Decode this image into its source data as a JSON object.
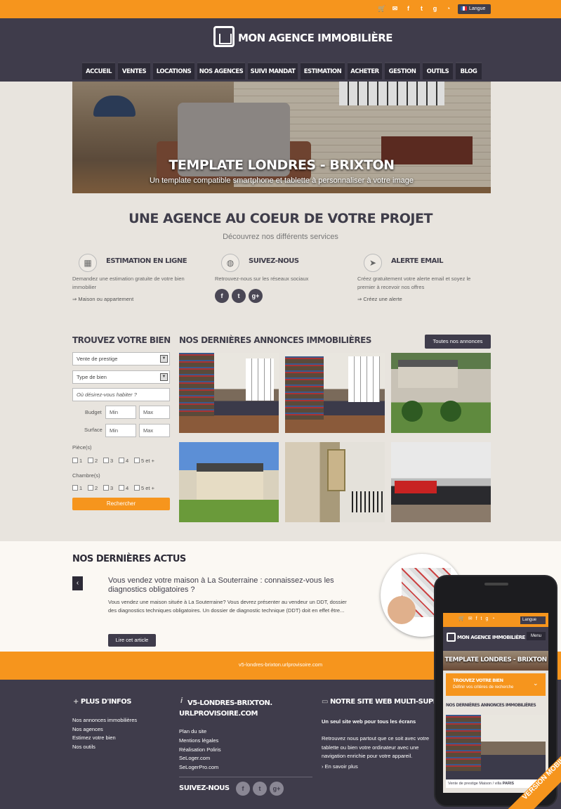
{
  "colors": {
    "accent": "#f6951d",
    "dark": "#3f3c4b",
    "background": "#e8e4de"
  },
  "topbar": {
    "icons": [
      "cart-icon",
      "mail-icon",
      "facebook-icon",
      "twitter-icon",
      "google-plus-icon",
      "rss-icon"
    ],
    "lang_label": "Langue"
  },
  "header": {
    "logo_text": "MON AGENCE IMMOBILIÈRE",
    "nav": [
      "ACCUEIL",
      "VENTES",
      "LOCATIONS",
      "NOS AGENCES",
      "SUIVI MANDAT",
      "ESTIMATION",
      "ACHETER",
      "GESTION",
      "OUTILS",
      "BLOG"
    ]
  },
  "hero": {
    "title": "TEMPLATE LONDRES - BRIXTON",
    "subtitle": "Un template compatible smartphone et tablette à personnaliser à votre image"
  },
  "agence": {
    "title": "UNE AGENCE AU COEUR DE VOTRE PROJET",
    "subtitle": "Découvrez nos différents services",
    "services": [
      {
        "icon": "calculator-icon",
        "title": "ESTIMATION EN LIGNE",
        "text": "Demandez une estimation gratuite de votre bien immobilier",
        "link": "Maison ou appartement"
      },
      {
        "icon": "globe-icon",
        "title": "SUIVEZ-NOUS",
        "text": "Retrouvez-nous sur les réseaux sociaux",
        "link": ""
      },
      {
        "icon": "paper-plane-icon",
        "title": "ALERTE EMAIL",
        "text": "Créez gratuitement votre alerte email et soyez le premier à recevoir nos offres",
        "link": "Créez une alerte"
      }
    ]
  },
  "search": {
    "title": "TROUVEZ VOTRE BIEN",
    "select1": "Vente de prestige",
    "select2": "Type de bien",
    "location_placeholder": "Où désirez-vous habiter ?",
    "budget_label": "Budget",
    "surface_label": "Surface",
    "min_placeholder": "Min",
    "max_placeholder": "Max",
    "pieces_label": "Pièce(s)",
    "chambres_label": "Chambre(s)",
    "options": [
      "1",
      "2",
      "3",
      "4",
      "5 et +"
    ],
    "button": "Rechercher"
  },
  "listings": {
    "title": "NOS DERNIÈRES ANNONCES IMMOBILIÈRES",
    "all_button": "Toutes nos annonces"
  },
  "actus": {
    "title": "NOS DERNIÈRES ACTUS",
    "headline": "Vous vendez votre maison à La Souterraine : connaissez-vous les diagnostics obligatoires ?",
    "text": "Vous vendez une maison située à La Souterraine? Vous devrez présenter au vendeur un DDT, dossier des diagnostics techniques obligatoires. Un dossier de diagnostic technique (DDT) doit en effet être...",
    "button": "Lire cet article"
  },
  "url_band": "v5-londres-brixton.urlprovisoire.com",
  "footer": {
    "col1": {
      "title": "PLUS D'INFOS",
      "links": [
        "Nos annonces immobilières",
        "Nos agences",
        "Estimez votre bien",
        "Nos outils"
      ]
    },
    "col2": {
      "title": "V5-LONDRES-BRIXTON.URLPROVISOIRE.COM",
      "links": [
        "Plan du site",
        "Mentions légales",
        "Réalisation Poliris",
        "SeLoger.com",
        "SeLogerPro.com"
      ],
      "follow": "SUIVEZ-NOUS"
    },
    "col3": {
      "title": "NOTRE SITE WEB MULTI-SUPPORTS",
      "subtitle": "Un seul site web pour tous les écrans",
      "text": "Retrouvez nous partout que ce soit avec votre tablette ou bien votre ordinateur avec une navigation enrichie pour votre appareil.",
      "link": "En savoir plus"
    }
  },
  "phone": {
    "logo": "MON AGENCE IMMOBILIÈRE",
    "menu": "Menu",
    "lang": "Langue",
    "hero": "TEMPLATE LONDRES - BRIXTON",
    "search_title": "TROUVEZ VOTRE BIEN",
    "search_sub": "Définir vos critères de recherche",
    "listings_title": "NOS DERNIÈRES ANNONCES IMMOBILIÈRES",
    "caption": "Vente de prestige Maison / villa",
    "caption_city": "PARIS",
    "ribbon": "VERSION MOBILE"
  }
}
